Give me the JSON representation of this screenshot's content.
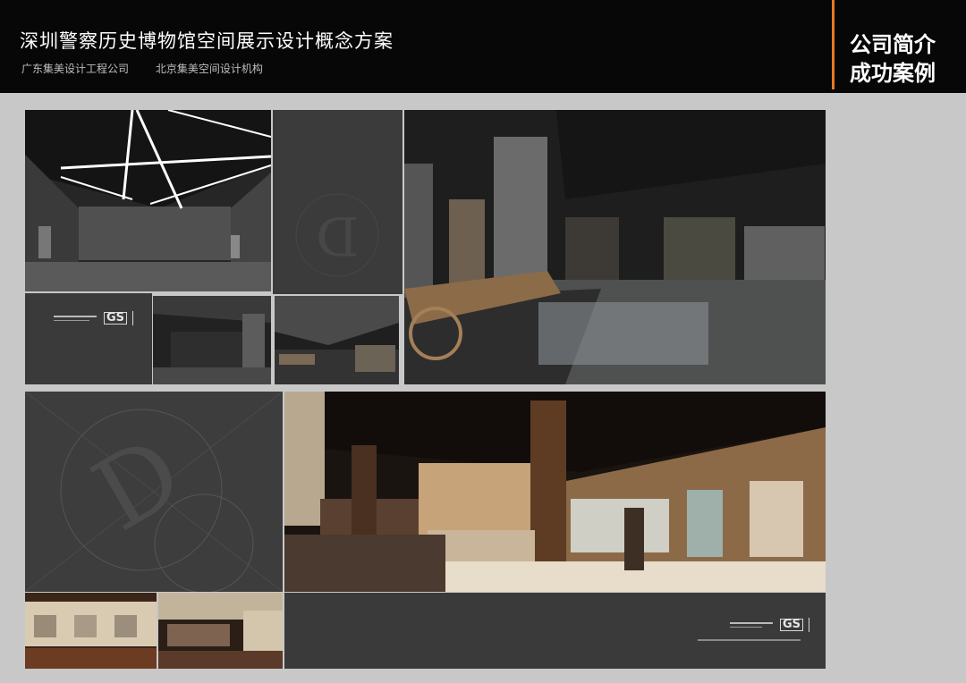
{
  "header": {
    "title": "深圳警察历史博物馆空间展示设计概念方案",
    "subtitle_left": "广东集美设计工程公司",
    "subtitle_right": "北京集美空间设计机构",
    "section_line1": "公司简介",
    "section_line2": "成功案例"
  },
  "colors": {
    "header_bg": "#070707",
    "accent": "#e87a1e",
    "page_bg": "#c8c8c8",
    "panel_bg": "#3a3a3a"
  },
  "panels": {
    "logo_mark": "GS",
    "emblem_letter": "D"
  }
}
